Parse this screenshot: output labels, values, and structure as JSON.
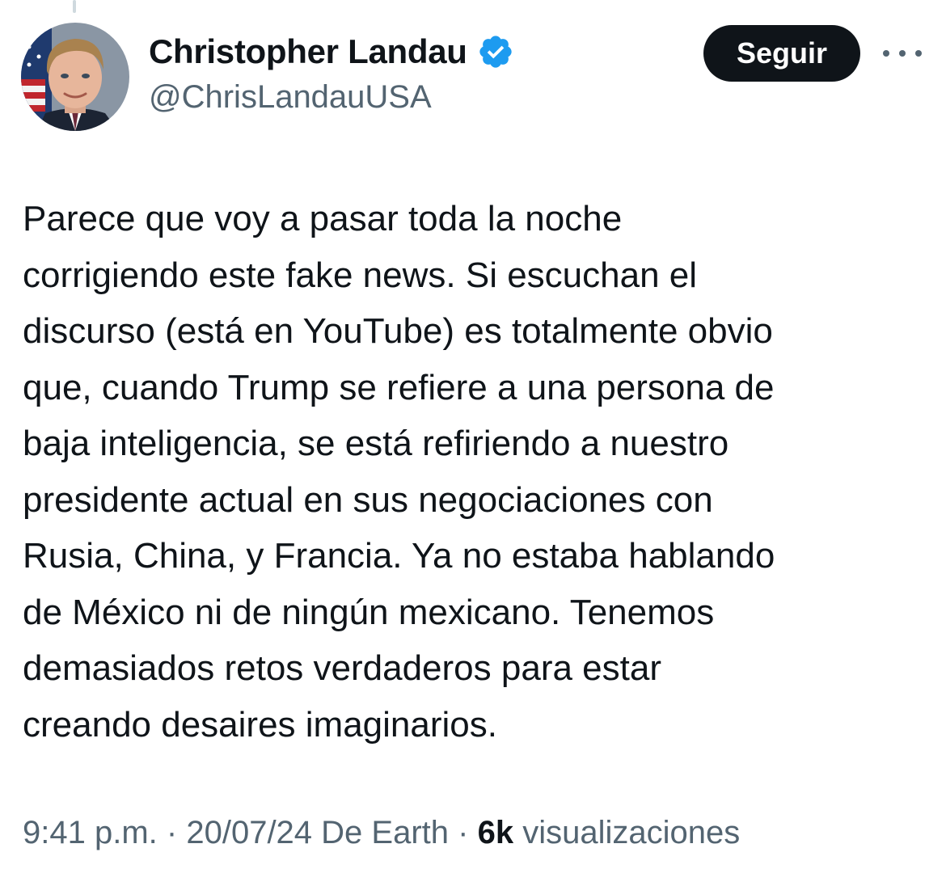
{
  "tweet": {
    "author": {
      "name": "Christopher Landau",
      "handle": "@ChrisLandauUSA",
      "verified_icon": "verified-badge-icon",
      "verified_color": "#1d9bf0"
    },
    "follow_label": "Seguir",
    "more_icon": "more-options-icon",
    "text": "Parece que voy a pasar toda la noche\ncorrigiendo este fake news. Si escuchan el\ndiscurso (está en YouTube) es totalmente obvio\nque, cuando Trump se refiere a una persona de\nbaja inteligencia, se está refiriendo a nuestro\npresidente actual en sus negociaciones con\nRusia, China, y Francia. Ya no estaba hablando\nde México ni de ningún mexicano. Tenemos\ndemasiados retos verdaderos para estar\ncreando desaires imaginarios.",
    "time": "9:41 p.m.",
    "separator": "·",
    "date": "20/07/24",
    "source": "De Earth",
    "views_count": "6k",
    "views_label": "visualizaciones"
  },
  "colors": {
    "text_primary": "#0f1419",
    "text_secondary": "#536471",
    "follow_button_bg": "#0f1419",
    "follow_button_text": "#ffffff"
  }
}
